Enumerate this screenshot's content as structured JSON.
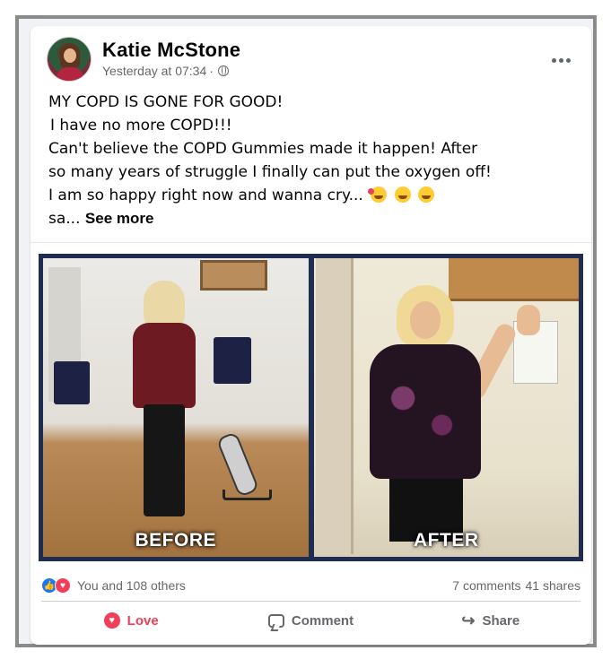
{
  "post": {
    "author": "Katie McStone",
    "timestamp": "Yesterday at 07:34",
    "separator": "·",
    "text_lines": [
      "MY COPD IS GONE FOR GOOD!",
      "I have no more COPD!!!",
      "Can't believe the COPD Gummies made it happen!  After",
      "so many years of struggle I finally can put the oxygen off!",
      "I am so happy right now and wanna cry...",
      "sa..."
    ],
    "see_more": "See more",
    "emojis": [
      "smiling-face-with-hearts-icon",
      "grinning-face-icon",
      "smiling-face-icon"
    ]
  },
  "image": {
    "before_label": "BEFORE",
    "after_label": "AFTER"
  },
  "reactions": {
    "like_glyph": "👍",
    "love_glyph": "♥",
    "summary": "You and 108 others",
    "comments": "7 comments",
    "shares": "41 shares"
  },
  "actions": {
    "love_glyph": "♥",
    "love": "Love",
    "comment": "Comment",
    "share_glyph": "↪",
    "share": "Share"
  },
  "colors": {
    "love_red": "#f33e58",
    "like_blue": "#1877f2",
    "secondary_text": "#65676b",
    "image_frame": "#1f2d52"
  }
}
